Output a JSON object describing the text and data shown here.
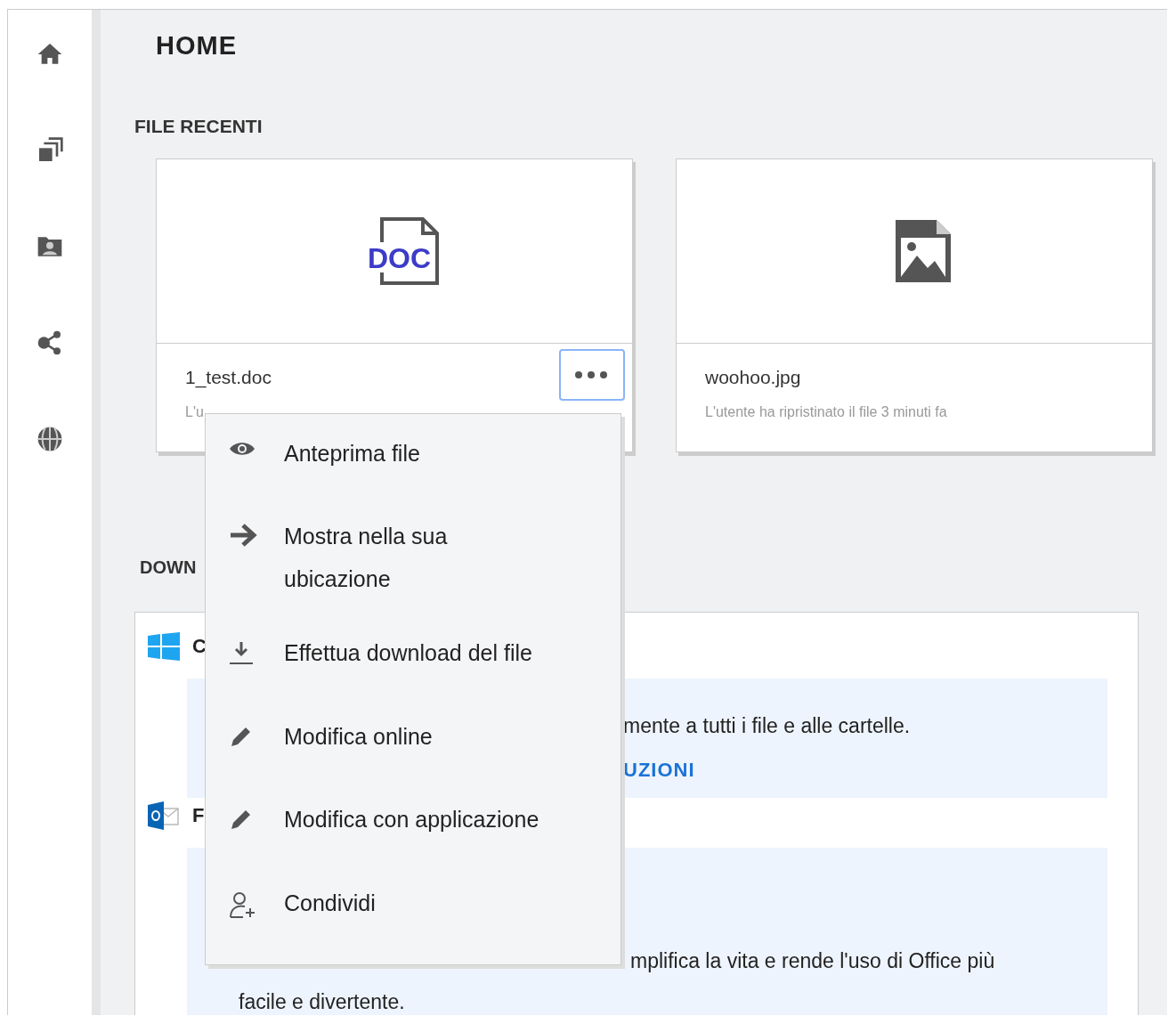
{
  "sidebar": {
    "items": [
      {
        "kind": "home"
      },
      {
        "kind": "stack"
      },
      {
        "kind": "personal"
      },
      {
        "kind": "share"
      },
      {
        "kind": "globe"
      }
    ]
  },
  "page": {
    "title": "HOME"
  },
  "recent": {
    "title": "FILE RECENTI",
    "files": [
      {
        "kind": "doc",
        "type_label": "DOC",
        "name": "1_test.doc",
        "activity": "L'u",
        "actions_button": {
          "focused": true
        }
      },
      {
        "kind": "image",
        "name": "woohoo.jpg",
        "activity": "L'utente ha ripristinato il file 3 minuti fa"
      }
    ]
  },
  "downloads": {
    "title": "DOWN",
    "sections": [
      {
        "kind": "windows",
        "title": "C",
        "lines": [
          "mente a tutti i file e alle cartelle."
        ],
        "link": "UZIONI"
      },
      {
        "kind": "outlook",
        "title": "F",
        "lines": [
          "mplifica la vita e rende l'uso di Office più",
          "facile e divertente."
        ]
      }
    ]
  },
  "context_menu": {
    "items": [
      {
        "kind": "eye",
        "label": "Anteprima file"
      },
      {
        "kind": "arrow",
        "label": "Mostra nella sua ubicazione"
      },
      {
        "kind": "download",
        "label": "Effettua download del file"
      },
      {
        "kind": "pencil",
        "label": "Modifica online"
      },
      {
        "kind": "pencil",
        "label": "Modifica con applicazione"
      },
      {
        "kind": "share-user",
        "label": "Condividi"
      }
    ]
  }
}
